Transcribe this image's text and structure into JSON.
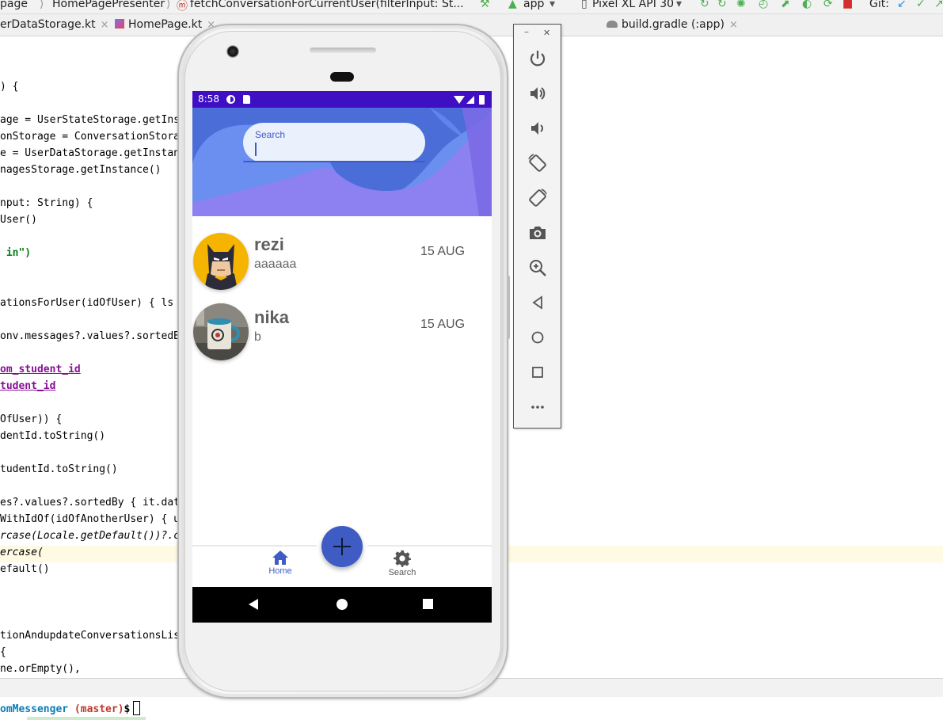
{
  "ide": {
    "toolbar": {
      "breadcrumb_page": "page",
      "breadcrumb_presenter": "HomePagePresenter",
      "breadcrumb_method": "fetchConversationForCurrentUser(filterInput: St...",
      "run_config": "app",
      "device": "Pixel XL API 30",
      "git_label": "Git:"
    },
    "tabs": [
      {
        "label": "erDataStorage.kt"
      },
      {
        "label": "HomePage.kt"
      },
      {
        "label": "build.gradle (:app)"
      }
    ],
    "code_lines": [
      ") {",
      "age = UserStateStorage.getIns",
      "onStorage = ConversationStora",
      "e = UserDataStorage.getInstan",
      "nagesStorage.getInstance()",
      "nput: String) {",
      "User()",
      " in\")",
      "ationsForUser(idOfUser) { ls",
      "onv.messages?.values?.sortedB",
      "om_student_id",
      "tudent_id",
      "OfUser)) {",
      "dentId.toString()",
      "tudentId.toString()",
      "es?.values?.sortedBy { it.dat",
      "WithIdOf(idOfAnotherUser) { u",
      "rcase(Locale.getDefault())?.c",
      "ercase(",
      "efault()",
      "tionAndupdateConversationsLis",
      "{",
      "ne.orEmpty(),"
    ],
    "terminal": {
      "path": "omMessenger",
      "branch": "(master)",
      "prompt": "$"
    }
  },
  "app": {
    "status_bar": {
      "time": "8:58"
    },
    "search": {
      "label": "Search",
      "value": ""
    },
    "conversations": [
      {
        "name": "rezi",
        "last_message": "aaaaaa",
        "date": "15 AUG",
        "avatar": "batman-avatar"
      },
      {
        "name": "nika",
        "last_message": "b",
        "date": "15 AUG",
        "avatar": "mug-photo-avatar"
      }
    ],
    "bottom_nav": {
      "home_label": "Home",
      "search_label": "Search",
      "active": "Home"
    },
    "fab_icon": "plus-icon"
  },
  "emulator_panel": {
    "buttons": [
      "power-icon",
      "volume-up-icon",
      "volume-down-icon",
      "rotate-left-icon",
      "rotate-right-icon",
      "camera-icon",
      "zoom-icon",
      "back-icon",
      "home-icon",
      "overview-icon",
      "more-icon"
    ]
  },
  "colors": {
    "accent": "#3f5cc5",
    "status_bar": "#3f0fc4",
    "header_blue": "#4a6dd8",
    "header_purple": "#8d80f0"
  }
}
